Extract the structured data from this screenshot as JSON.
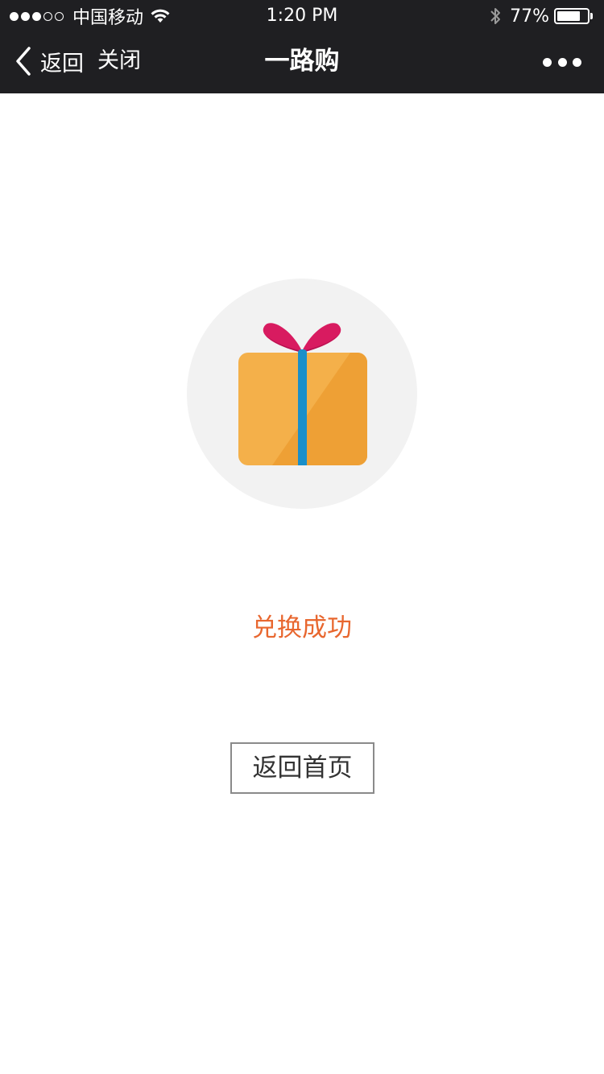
{
  "status_bar": {
    "signal_dots_filled": 3,
    "signal_dots_total": 5,
    "carrier": "中国移动",
    "time": "1:20 PM",
    "battery_percent_label": "77%",
    "battery_level": 0.77,
    "icons": [
      "signal-icon",
      "wifi-icon",
      "bluetooth-icon",
      "battery-icon"
    ]
  },
  "nav_bar": {
    "back_label": "返回",
    "close_label": "关闭",
    "title": "一路购",
    "icons": [
      "chevron-left-icon",
      "more-icon"
    ]
  },
  "main": {
    "illustration": "gift-icon",
    "success_message": "兑换成功",
    "home_button_label": "返回首页"
  },
  "colors": {
    "bar_background": "#1f1f22",
    "success_text": "#e8672f",
    "gift_box": "#f4b04a",
    "gift_box_shadow": "#eea035",
    "ribbon": "#1a8fc9",
    "bow": "#d81b60",
    "circle_background": "#f2f2f2"
  }
}
